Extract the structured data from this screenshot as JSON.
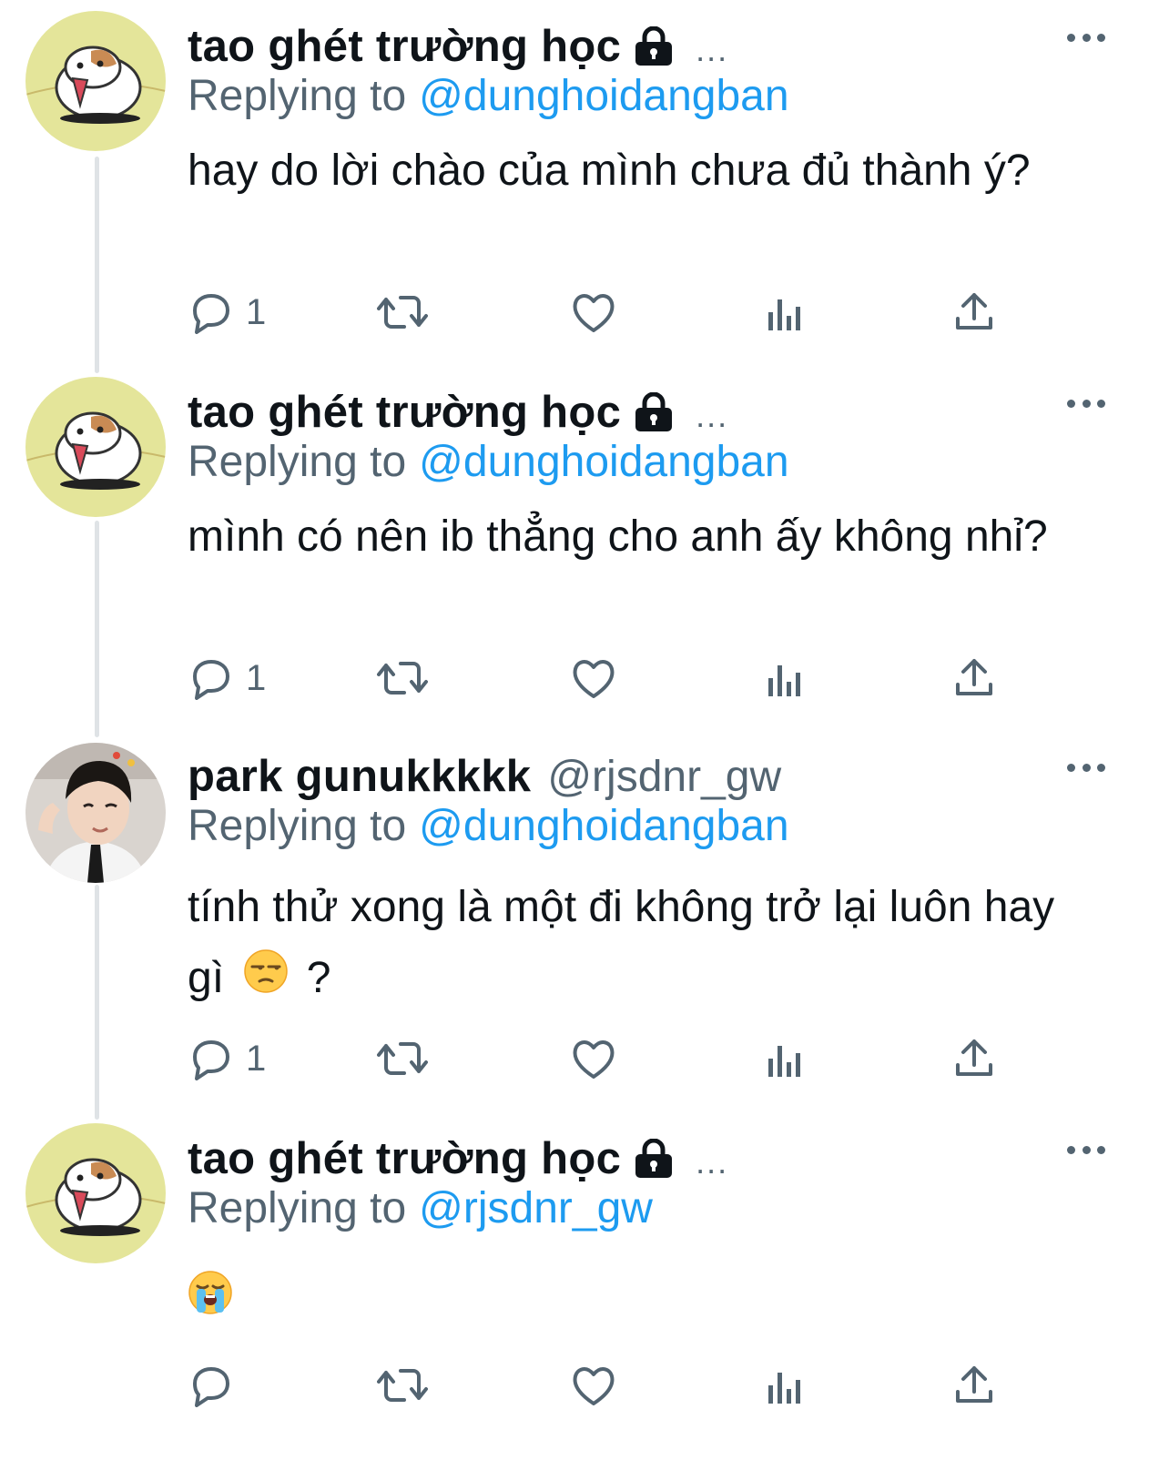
{
  "tweets": [
    {
      "display_name": "tao ghét trường học",
      "handle": "",
      "protected": true,
      "truncation": "...",
      "reply_prefix": "Replying to",
      "reply_to": "@dunghoidangban",
      "text": "hay do lời chào của mình chưa đủ thành ý?",
      "reply_count": "1",
      "avatar": "hamster-avatar"
    },
    {
      "display_name": "tao ghét trường học",
      "handle": "",
      "protected": true,
      "truncation": "...",
      "reply_prefix": "Replying to",
      "reply_to": "@dunghoidangban",
      "text": "mình có nên ib thẳng cho anh ấy không nhỉ?",
      "reply_count": "1",
      "avatar": "hamster-avatar"
    },
    {
      "display_name": "park gunukkkkk",
      "handle": "@rjsdnr_gw",
      "protected": false,
      "truncation": "",
      "reply_prefix": "Replying to",
      "reply_to": "@dunghoidangban",
      "text": "tính thử xong là một đi không trở lại luôn hay gì",
      "text_suffix": "?",
      "text_emoji": "unamused-face-emoji",
      "reply_count": "1",
      "avatar": "person-photo-avatar"
    },
    {
      "display_name": "tao ghét trường học",
      "handle": "",
      "protected": true,
      "truncation": "...",
      "reply_prefix": "Replying to",
      "reply_to": "@rjsdnr_gw",
      "text": "",
      "text_emoji": "loudly-crying-face-emoji",
      "reply_count": "",
      "avatar": "hamster-avatar"
    }
  ],
  "icons": {
    "reply": "reply-icon",
    "retweet": "retweet-icon",
    "like": "like-icon",
    "views": "views-icon",
    "share": "share-icon",
    "more": "more-icon",
    "lock": "lock-icon"
  },
  "colors": {
    "link": "#1d9bf0",
    "secondary_text": "#536471",
    "primary_text": "#0f1419",
    "thread_line": "#dfe3e6",
    "avatar_bg": "#e4e59a"
  }
}
